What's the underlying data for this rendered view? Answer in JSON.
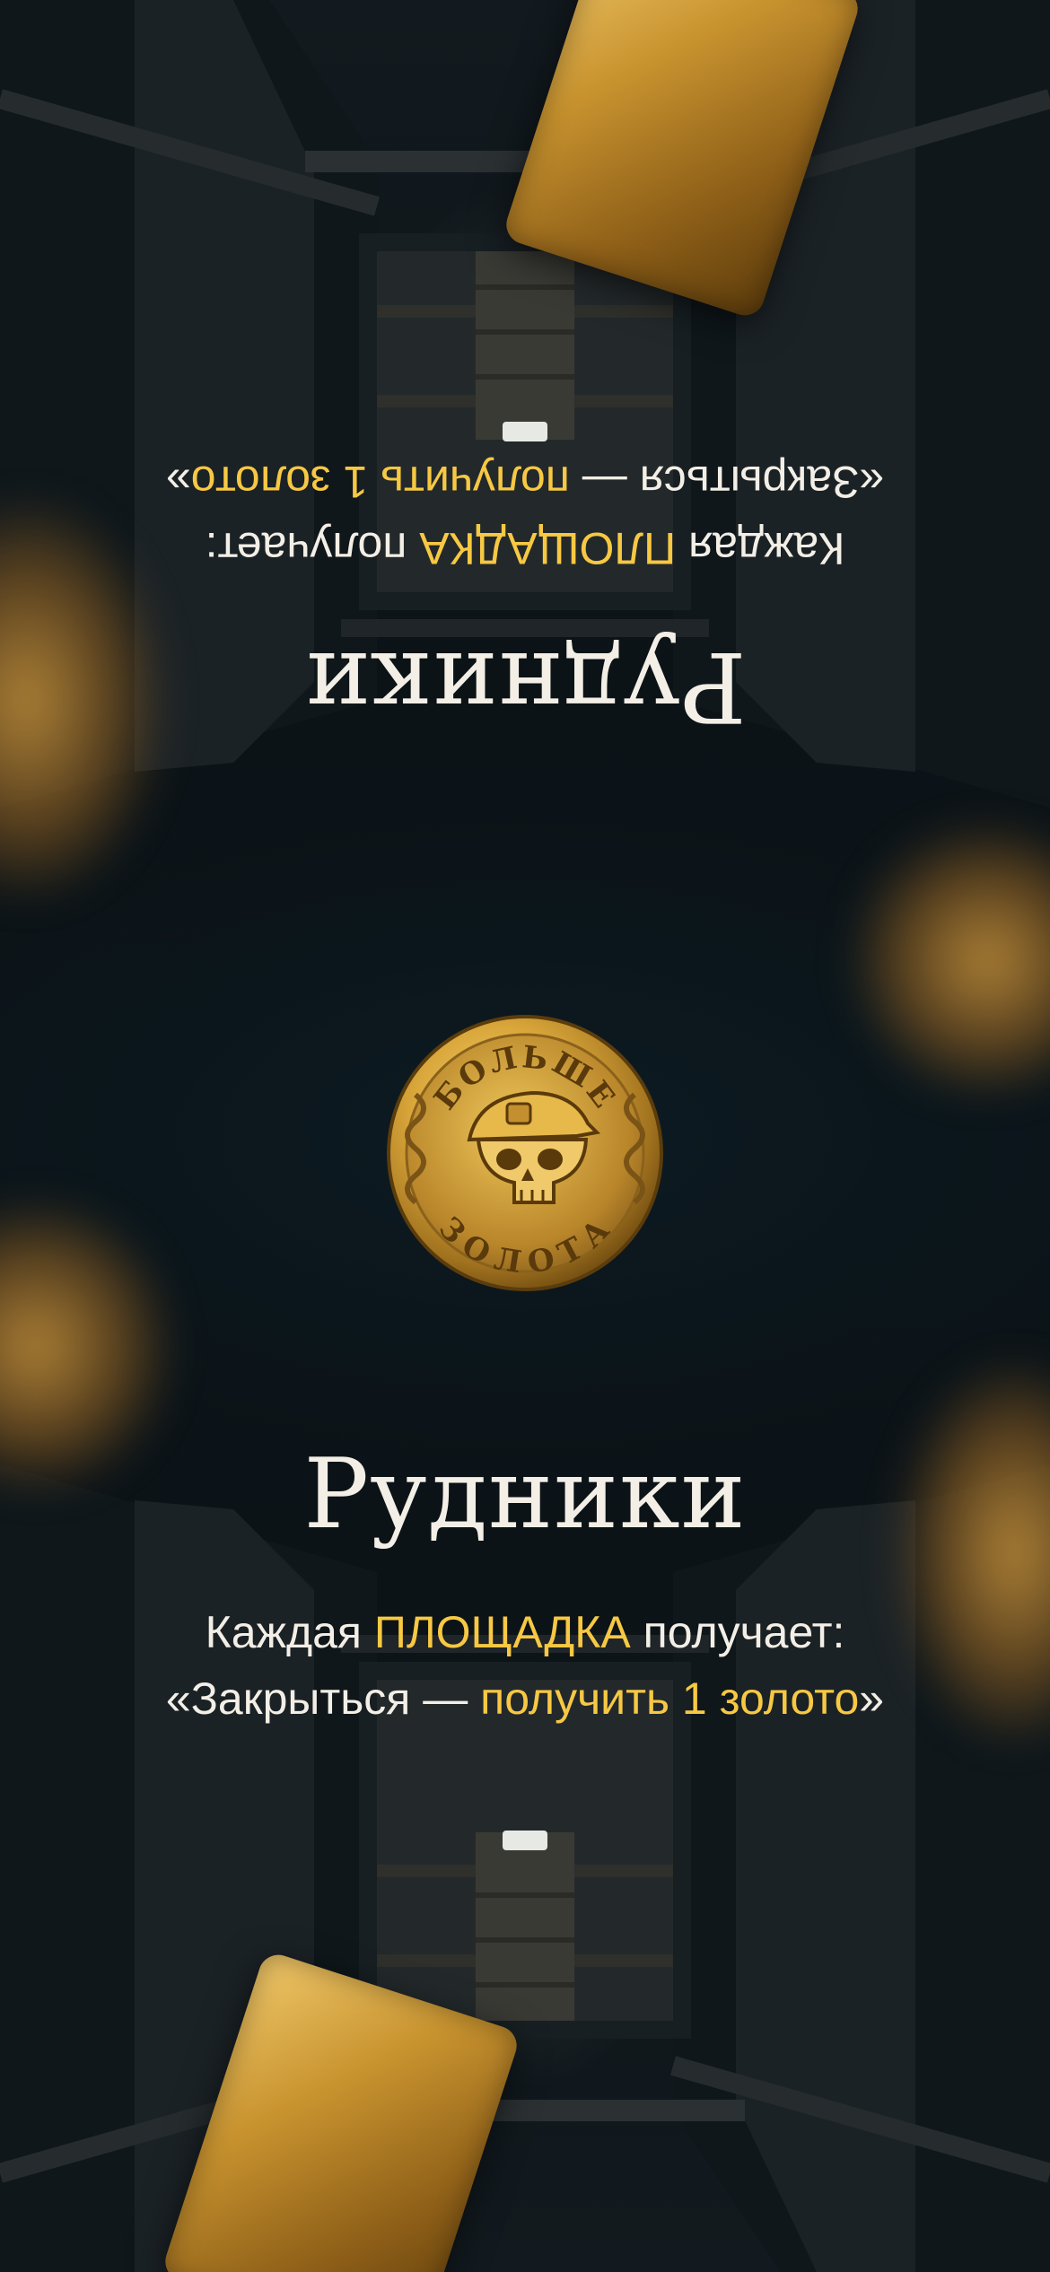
{
  "card": {
    "title": "Рудники",
    "line1": {
      "prefix": "Каждая ",
      "highlight": "ПЛОЩАДКА",
      "suffix": " получает:"
    },
    "line2": {
      "prefix": "«Закрыться — ",
      "highlight": "получить 1 золото",
      "suffix": "»"
    }
  },
  "coin": {
    "top_text": "БОЛЬШЕ",
    "bottom_text": "ЗОЛОТА",
    "icon": "skull-miner-icon"
  },
  "colors": {
    "accent": "#f7c843",
    "text": "#f3efe6",
    "background": "#0b1014",
    "gold": "#c8932f"
  }
}
